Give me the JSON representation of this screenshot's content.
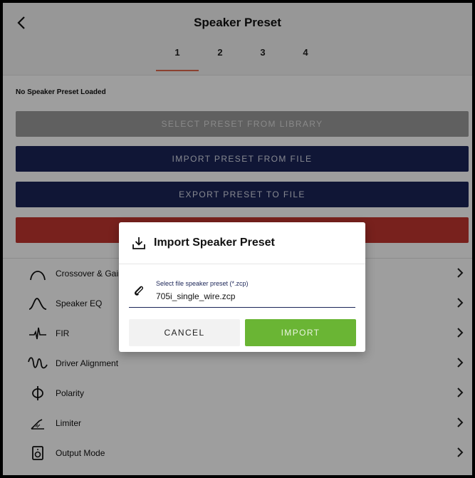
{
  "header": {
    "title": "Speaker Preset",
    "tabs": [
      "1",
      "2",
      "3",
      "4"
    ],
    "active_tab": "1"
  },
  "status": "No Speaker Preset Loaded",
  "buttons": {
    "select_library": "SELECT PRESET FROM LIBRARY",
    "import_file": "IMPORT PRESET FROM FILE",
    "export_file": "EXPORT PRESET TO FILE",
    "red_button": ""
  },
  "menu": [
    {
      "label": "Crossover & Gain",
      "icon": "crossover-icon"
    },
    {
      "label": "Speaker EQ",
      "icon": "speaker-eq-icon"
    },
    {
      "label": "FIR",
      "icon": "fir-icon"
    },
    {
      "label": "Driver Alignment",
      "icon": "driver-alignment-icon"
    },
    {
      "label": "Polarity",
      "icon": "polarity-icon"
    },
    {
      "label": "Limiter",
      "icon": "limiter-icon"
    },
    {
      "label": "Output Mode",
      "icon": "output-mode-icon"
    }
  ],
  "dialog": {
    "title": "Import Speaker Preset",
    "field_label": "Select file speaker preset (*.zcp)",
    "field_value": "705i_single_wire.zcp",
    "cancel": "CANCEL",
    "import": "IMPORT"
  },
  "colors": {
    "navy": "#1b2557",
    "red": "#c2362f",
    "green": "#6ab534",
    "accent": "#e06a4e",
    "grey_button": "#9b9b9b"
  }
}
